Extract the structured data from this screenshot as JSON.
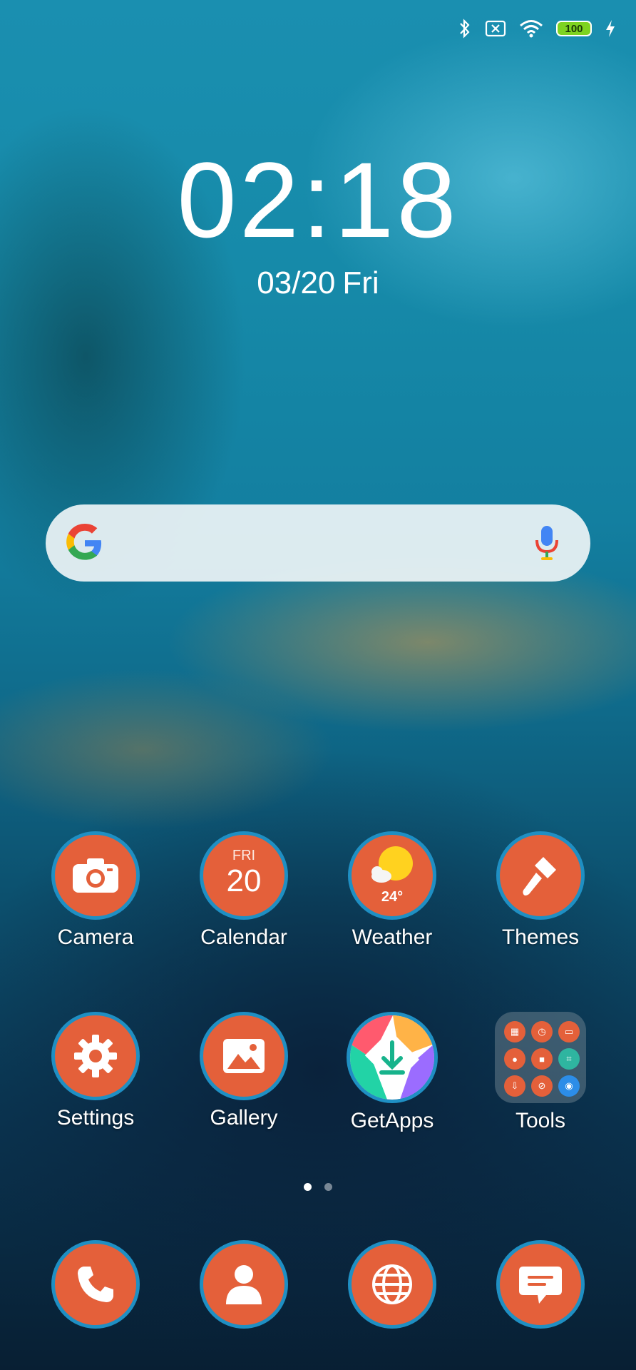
{
  "status_bar": {
    "icons": [
      "bluetooth-icon",
      "no-sim-icon",
      "wifi-icon",
      "battery-icon",
      "charging-icon"
    ],
    "battery_level": "100"
  },
  "lockscreen": {
    "time": "02:18",
    "date": "03/20",
    "weekday": "Fri"
  },
  "search": {
    "icons": [
      "google-logo-icon",
      "microphone-icon"
    ]
  },
  "apps": [
    {
      "label": "Camera",
      "icon": "camera-icon"
    },
    {
      "label": "Calendar",
      "icon": "calendar-icon",
      "day": "FRI",
      "date": "20"
    },
    {
      "label": "Weather",
      "icon": "weather-icon",
      "temp": "24°"
    },
    {
      "label": "Themes",
      "icon": "paintbrush-icon"
    },
    {
      "label": "Settings",
      "icon": "gear-icon"
    },
    {
      "label": "Gallery",
      "icon": "image-icon"
    },
    {
      "label": "GetApps",
      "icon": "getapps-icon"
    },
    {
      "label": "Tools",
      "icon": "folder-icon"
    }
  ],
  "page_indicator": {
    "pages": 2,
    "current": 1
  },
  "dock": [
    {
      "name": "phone",
      "icon": "phone-icon"
    },
    {
      "name": "contacts",
      "icon": "contacts-icon"
    },
    {
      "name": "browser",
      "icon": "globe-icon"
    },
    {
      "name": "messages",
      "icon": "message-icon"
    }
  ],
  "colors": {
    "icon_fill": "#e4603a",
    "icon_ring": "#1f8fc3",
    "battery_fill": "#7ed321"
  }
}
